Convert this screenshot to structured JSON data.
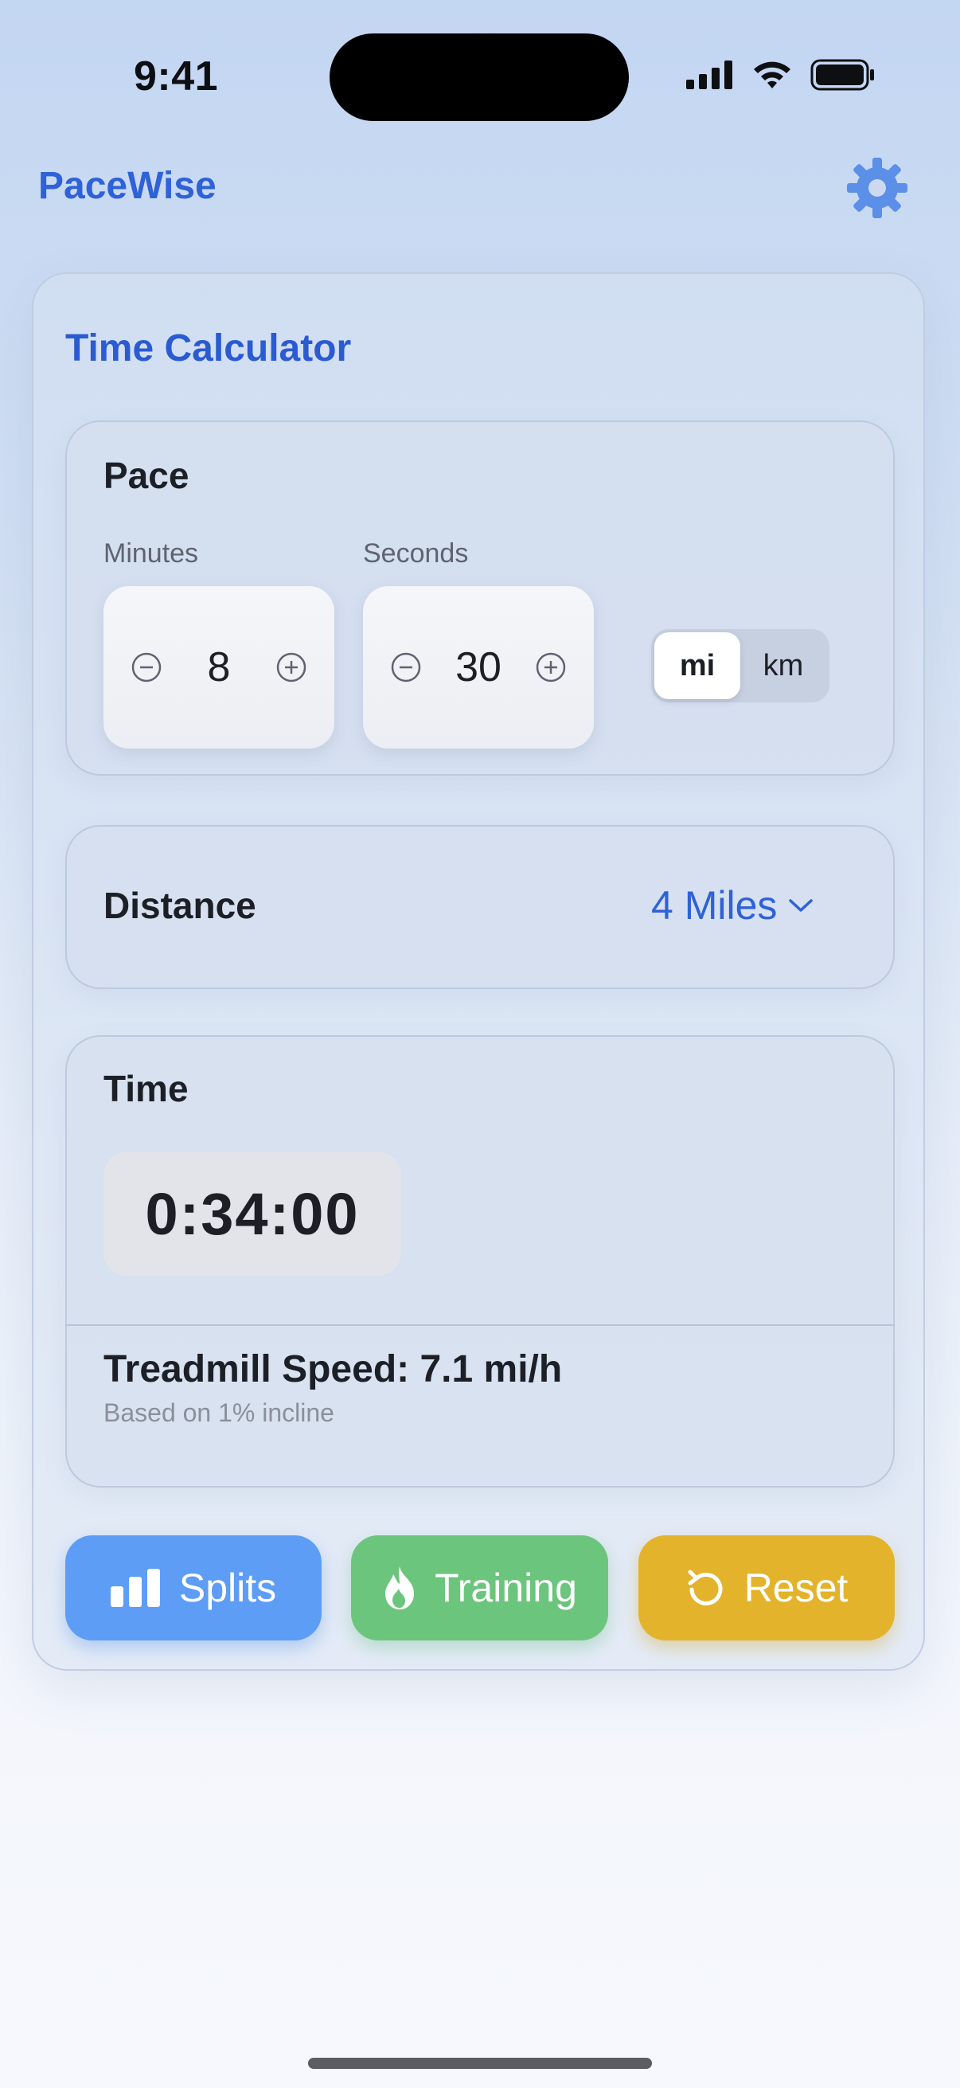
{
  "status_bar": {
    "time": "9:41"
  },
  "header": {
    "app_name": "PaceWise",
    "settings_icon": "gear-icon"
  },
  "calculator": {
    "title": "Time Calculator",
    "pace": {
      "heading": "Pace",
      "minutes_label": "Minutes",
      "minutes_value": "8",
      "seconds_label": "Seconds",
      "seconds_value": "30",
      "units": [
        "mi",
        "km"
      ],
      "selected_unit": "mi"
    },
    "distance": {
      "label": "Distance",
      "value": "4 Miles"
    },
    "time": {
      "heading": "Time",
      "value": "0:34:00",
      "treadmill_speed": "Treadmill Speed: 7.1 mi/h",
      "incline_note": "Based on 1% incline"
    },
    "actions": [
      {
        "label": "Splits",
        "icon": "bar-chart-icon",
        "color": "#5d9df5"
      },
      {
        "label": "Training",
        "icon": "flame-icon",
        "color": "#6cc57c"
      },
      {
        "label": "Reset",
        "icon": "reset-icon",
        "color": "#e3b32b"
      }
    ]
  },
  "colors": {
    "accent": "#2f61d8",
    "background": "#d3e0f3"
  }
}
